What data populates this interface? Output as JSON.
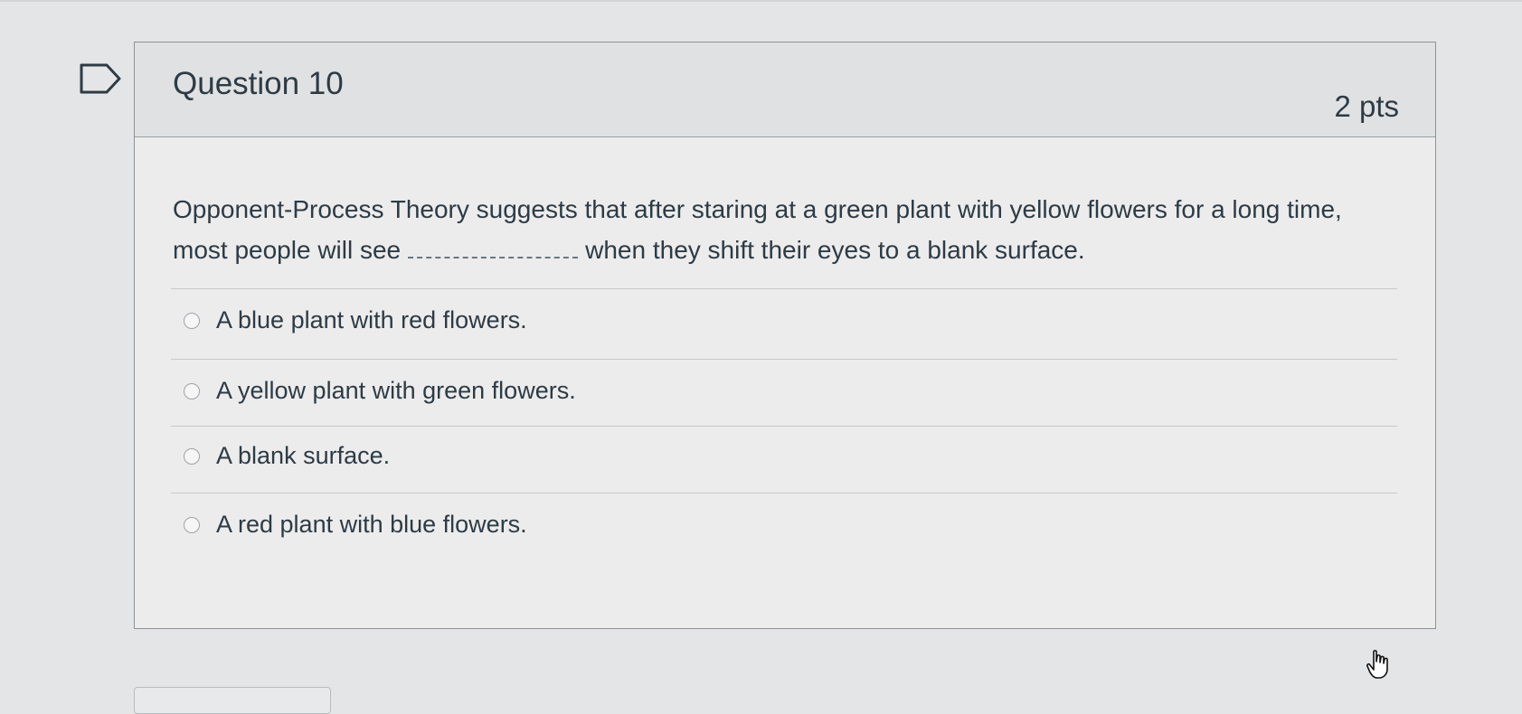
{
  "question": {
    "title": "Question 10",
    "points": "2 pts",
    "text_before": "Opponent-Process Theory suggests that after staring at a green plant with yellow flowers for a long time, most people will see",
    "text_after": "when they shift their eyes to a blank surface."
  },
  "answers": [
    {
      "label": "A blue plant with red flowers.",
      "selected": false
    },
    {
      "label": "A yellow plant with green flowers.",
      "selected": false
    },
    {
      "label": "A blank surface.",
      "selected": false
    },
    {
      "label": "A red plant with blue flowers.",
      "selected": false
    }
  ],
  "icons": {
    "flag": "flag-icon",
    "cursor": "hand-pointer-icon"
  },
  "colors": {
    "text": "#2d3b45",
    "header_bg": "#e0e1e2",
    "border": "#8e9296"
  }
}
